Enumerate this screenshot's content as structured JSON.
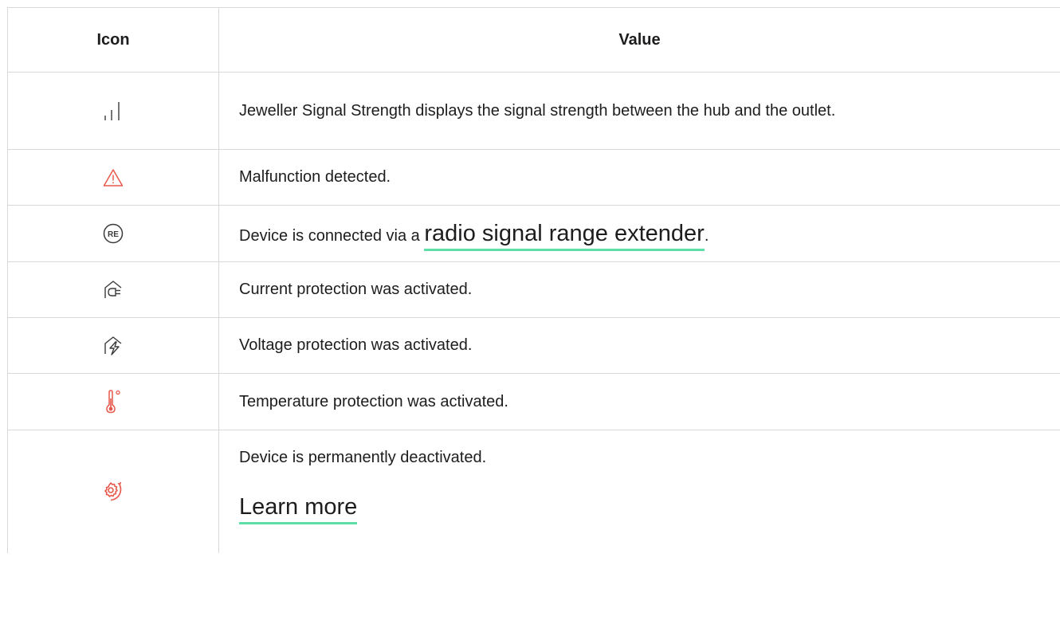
{
  "table": {
    "headers": {
      "icon": "Icon",
      "value": "Value"
    },
    "rows": [
      {
        "icon": "signal-strength-icon",
        "text": "Jeweller Signal Strength displays the signal strength between the hub and the outlet."
      },
      {
        "icon": "malfunction-warning-icon",
        "text": "Malfunction detected."
      },
      {
        "icon": "range-extender-icon",
        "text": "Device is connected via a ",
        "link": "radio signal range extender",
        "suffix": "."
      },
      {
        "icon": "current-protection-icon",
        "text": "Current protection was activated."
      },
      {
        "icon": "voltage-protection-icon",
        "text": "Voltage protection was activated."
      },
      {
        "icon": "temperature-protection-icon",
        "text": "Temperature protection was activated."
      },
      {
        "icon": "permanently-deactivated-icon",
        "text": "Device is permanently deactivated.",
        "link": "Learn more"
      }
    ]
  },
  "colors": {
    "accent_red": "#e7584b",
    "link_underline": "#5edfa8",
    "icon_dark": "#3a3a3a",
    "border": "#d9d9d9"
  }
}
